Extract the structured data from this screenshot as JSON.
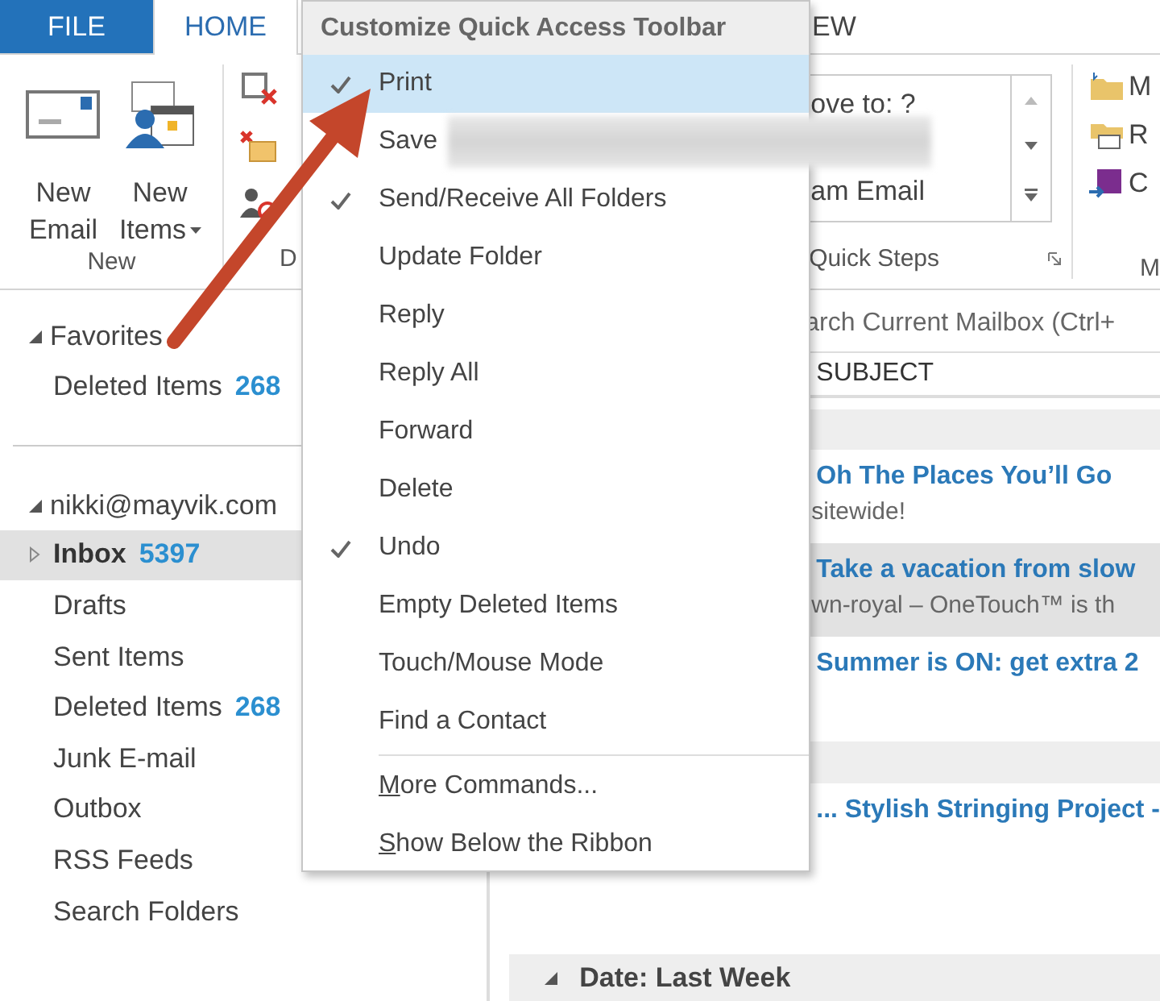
{
  "ribbon_tabs": [
    {
      "label": "FILE",
      "kind": "file",
      "selected": false
    },
    {
      "label": "HOME",
      "kind": "tab",
      "selected": true
    },
    {
      "label": "EW",
      "kind": "tab",
      "selected": false
    }
  ],
  "ribbon": {
    "new_group": {
      "label": "New",
      "buttons": [
        {
          "label": "New Email",
          "kind": "email",
          "dropdown": false
        },
        {
          "label": "New Items",
          "kind": "items",
          "dropdown": true
        }
      ]
    },
    "delete_group": {
      "label": "D"
    },
    "quick_steps": {
      "label": "Quick Steps",
      "items": [
        "ove to: ?",
        "am Email"
      ]
    },
    "move_group": {
      "label": "M",
      "items": [
        {
          "label": "M",
          "kind": "move"
        },
        {
          "label": "R",
          "kind": "rules"
        },
        {
          "label": "C",
          "kind": "onenote"
        }
      ]
    }
  },
  "folder_pane": {
    "favorites": {
      "label": "Favorites",
      "expanded": true,
      "items": [
        {
          "label": "Deleted Items",
          "count": "268",
          "selected": false,
          "has_children": false
        }
      ]
    },
    "account": {
      "label": "nikki@mayvik.com",
      "expanded": true,
      "folders": [
        {
          "label": "Inbox",
          "count": "5397",
          "selected": true,
          "has_children": true
        },
        {
          "label": "Drafts",
          "selected": false,
          "has_children": false
        },
        {
          "label": "Sent Items",
          "selected": false,
          "has_children": false
        },
        {
          "label": "Deleted Items",
          "count": "268",
          "selected": false,
          "has_children": false
        },
        {
          "label": "Junk E-mail",
          "selected": false,
          "has_children": false
        },
        {
          "label": "Outbox",
          "selected": false,
          "has_children": false
        },
        {
          "label": "RSS Feeds",
          "selected": false,
          "has_children": false
        },
        {
          "label": "Search Folders",
          "selected": false,
          "has_children": false
        }
      ]
    }
  },
  "mail_pane": {
    "search": {
      "placeholder": "arch Current Mailbox (Ctrl+"
    },
    "column": "SUBJECT",
    "rows": [
      {
        "kind": "header"
      },
      {
        "kind": "mail",
        "subject": "Oh The Places You’ll Go",
        "preview": "sitewide!",
        "selected": false
      },
      {
        "kind": "mail",
        "subject": "Take a vacation from slow",
        "preview": "wn-royal – OneTouch™ is th",
        "selected": true
      },
      {
        "kind": "mail",
        "subject": "Summer is ON: get extra 2",
        "selected": false
      },
      {
        "kind": "header"
      },
      {
        "kind": "mail",
        "subject": "... Stylish Stringing Project -",
        "selected": false
      },
      {
        "kind": "spacer"
      },
      {
        "kind": "header",
        "label": "Date: Last Week",
        "expanded": true
      }
    ]
  },
  "qat_menu": {
    "title": "Customize Quick Access Toolbar",
    "items": [
      {
        "label": "Print",
        "checked": true,
        "selected": true
      },
      {
        "label": "Save",
        "checked": false,
        "selected": false,
        "redacted": true
      },
      {
        "label": "Send/Receive All Folders",
        "checked": true,
        "selected": false
      },
      {
        "label": "Update Folder",
        "checked": false,
        "selected": false
      },
      {
        "label": "Reply",
        "checked": false,
        "selected": false
      },
      {
        "label": "Reply All",
        "checked": false,
        "selected": false
      },
      {
        "label": "Forward",
        "checked": false,
        "selected": false
      },
      {
        "label": "Delete",
        "checked": false,
        "selected": false
      },
      {
        "label": "Undo",
        "checked": true,
        "selected": false
      },
      {
        "label": "Empty Deleted Items",
        "checked": false,
        "selected": false
      },
      {
        "label": "Touch/Mouse Mode",
        "checked": false,
        "selected": false
      },
      {
        "label": "Find a Contact",
        "checked": false,
        "selected": false
      },
      {
        "label": "More Commands...",
        "checked": false,
        "selected": false,
        "separator_before": true,
        "underline_first": true
      },
      {
        "label": "Show Below the Ribbon",
        "checked": false,
        "selected": false,
        "underline_first": true
      }
    ]
  },
  "annotation": {
    "kind": "arrow"
  }
}
